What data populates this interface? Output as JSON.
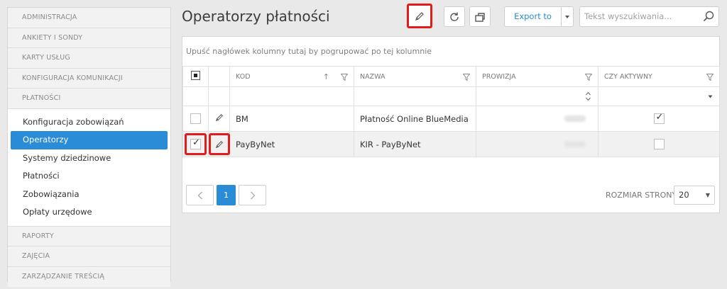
{
  "sidebar": {
    "sections_top": [
      "ADMINISTRACJA",
      "ANKIETY I SONDY",
      "KARTY USŁUG",
      "KONFIGURACJA KOMUNIKACJI",
      "PŁATNOŚCI"
    ],
    "subitems": [
      "Konfiguracja zobowiązań",
      "Operatorzy",
      "Systemy dziedzinowe",
      "Płatności",
      "Zobowiązania",
      "Opłaty urzędowe"
    ],
    "active_subitem": "Operatorzy",
    "sections_bottom": [
      "RAPORTY",
      "ZAJĘCIA",
      "ZARZĄDZANIE TREŚCIĄ"
    ]
  },
  "header": {
    "title": "Operatorzy płatności",
    "export_label": "Export to",
    "search_placeholder": "Tekst wyszukiwania...",
    "icons": [
      "pencil-icon",
      "refresh-icon",
      "columns-icon",
      "chevron-down-icon",
      "search-icon"
    ]
  },
  "grid": {
    "group_hint": "Upuść nagłówek kolumny tutaj by pogrupować po tej kolumnie",
    "columns": [
      "KOD",
      "NAZWA",
      "PROWIZJA",
      "CZY AKTYWNY"
    ],
    "rows": [
      {
        "kod": "BM",
        "nazwa": "Płatność Online BlueMedia",
        "selected": false,
        "active": true
      },
      {
        "kod": "PayByNet",
        "nazwa": "KIR - PayByNet",
        "selected": true,
        "active": false
      }
    ]
  },
  "pager": {
    "current_page": "1",
    "page_size_label": "ROZMIAR STRONY",
    "page_size": "20"
  },
  "colors": {
    "accent": "#2a8bd6",
    "highlight": "#e21b1b",
    "background": "#e9e9e9"
  }
}
